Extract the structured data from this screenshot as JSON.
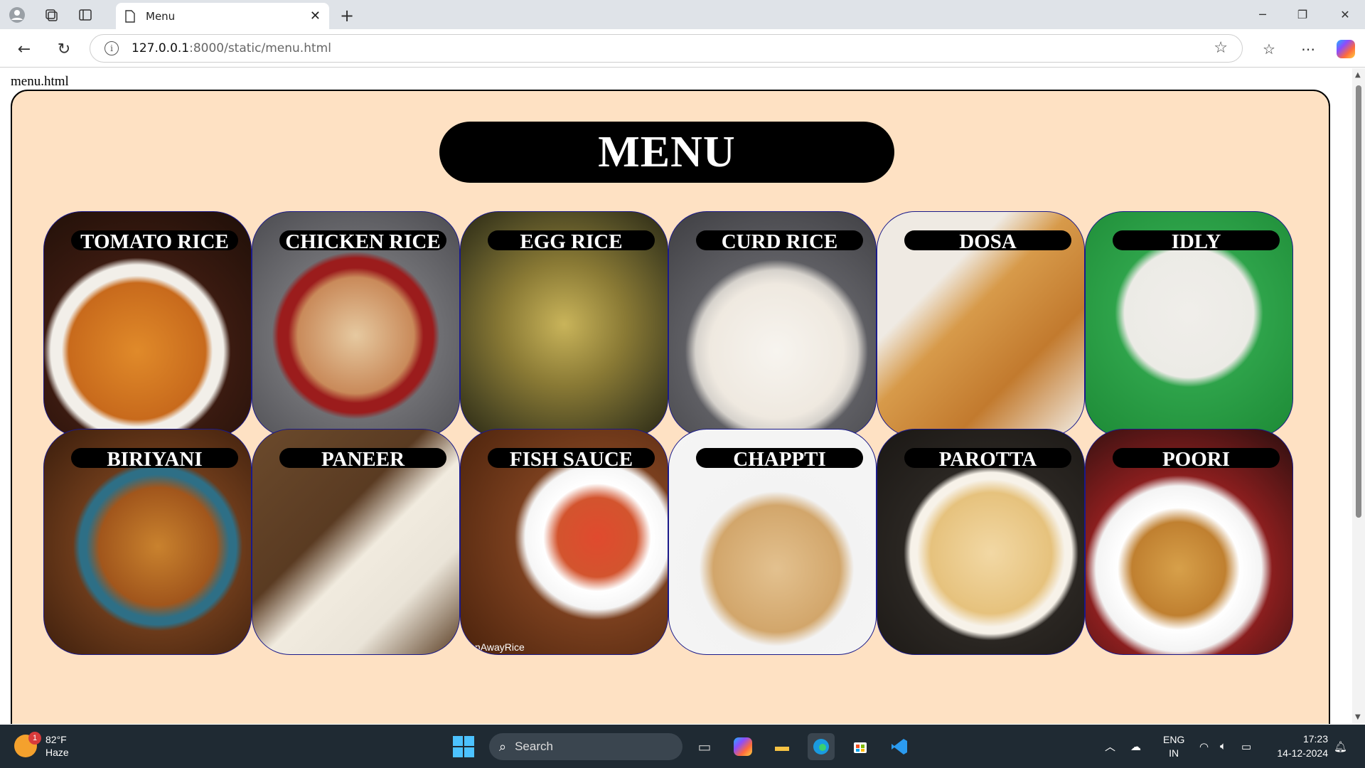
{
  "browser": {
    "tab_title": "Menu",
    "url_host": "127.0.0.1",
    "url_path": ":8000/static/menu.html"
  },
  "page": {
    "file_label": "menu.html",
    "heading": "MENU",
    "background_color": "#fee1c3",
    "items": [
      {
        "label": "TOMATO RICE",
        "image": "tomato-rice-photo"
      },
      {
        "label": "CHICKEN RICE",
        "image": "chicken-rice-photo"
      },
      {
        "label": "EGG RICE",
        "image": "egg-rice-photo"
      },
      {
        "label": "CURD RICE",
        "image": "curd-rice-photo"
      },
      {
        "label": "DOSA",
        "image": "dosa-photo"
      },
      {
        "label": "IDLY",
        "image": "idly-photo"
      },
      {
        "label": "BIRIYANI",
        "image": "biriyani-photo"
      },
      {
        "label": "PANEER",
        "image": "paneer-photo"
      },
      {
        "label": "FISH SAUCE",
        "image": "fish-sauce-photo"
      },
      {
        "label": "CHAPPTI",
        "image": "chappti-photo"
      },
      {
        "label": "PAROTTA",
        "image": "parotta-photo"
      },
      {
        "label": "POORI",
        "image": "poori-photo"
      }
    ],
    "watermark": "nAwayRice"
  },
  "taskbar": {
    "weather_temp": "82°F",
    "weather_desc": "Haze",
    "weather_badge": "1",
    "search_placeholder": "Search",
    "lang_top": "ENG",
    "lang_bottom": "IN",
    "time": "17:23",
    "date": "14-12-2024"
  }
}
